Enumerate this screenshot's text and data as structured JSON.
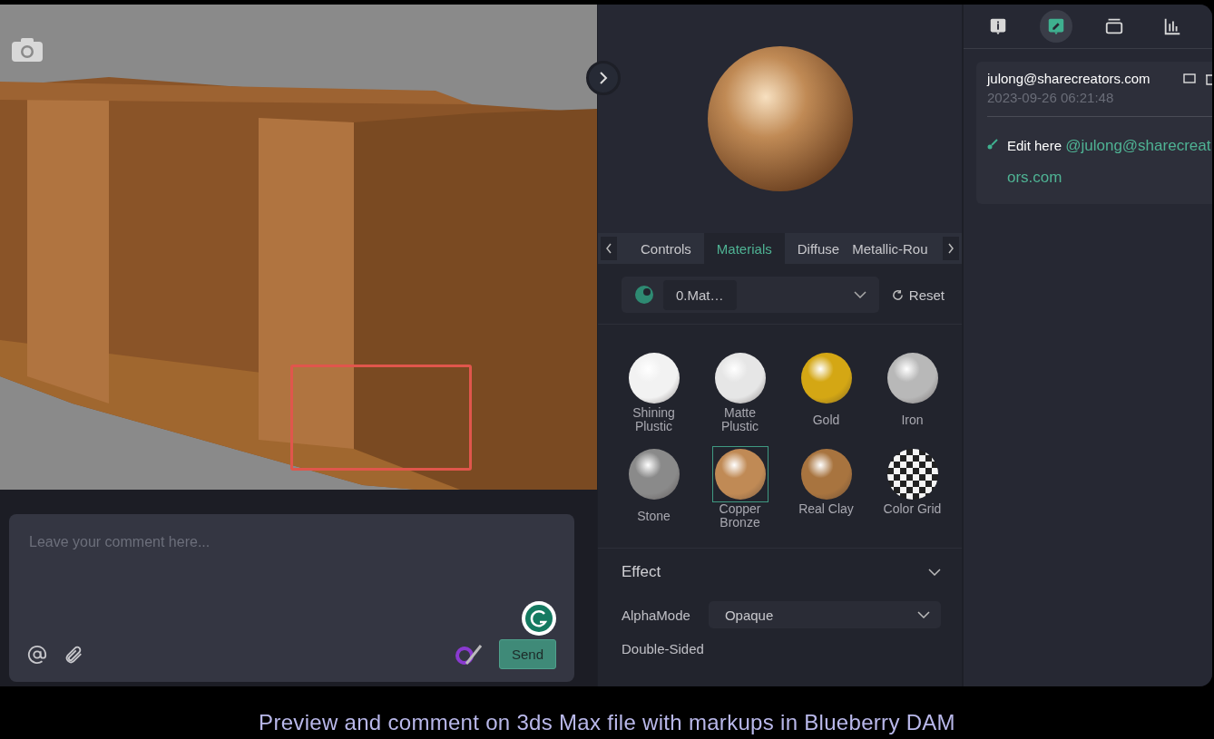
{
  "viewport": {
    "markup": true
  },
  "comment_box": {
    "placeholder": "Leave your comment here...",
    "send": "Send"
  },
  "material_panel": {
    "tabs": [
      {
        "label": "Controls",
        "selected": false
      },
      {
        "label": "Materials",
        "selected": true
      },
      {
        "label": "Diffuse",
        "selected": false
      },
      {
        "label": "Metallic-Rou",
        "selected": false
      }
    ],
    "material_select": "0.Mat…",
    "reset": "Reset",
    "materials": [
      {
        "name": "Shining Plustic",
        "kind": "solid",
        "color": "#f2f2f2",
        "selected": false
      },
      {
        "name": "Matte Plustic",
        "kind": "solid",
        "color": "#e6e6e6",
        "selected": false
      },
      {
        "name": "Gold",
        "kind": "solid",
        "color": "#d4a714",
        "selected": false
      },
      {
        "name": "Iron",
        "kind": "solid",
        "color": "#b8b8b8",
        "selected": false
      },
      {
        "name": "Stone",
        "kind": "solid",
        "color": "#8a8a8a",
        "selected": false
      },
      {
        "name": "Copper Bronze",
        "kind": "solid",
        "color": "#c08a55",
        "selected": true
      },
      {
        "name": "Real Clay",
        "kind": "solid",
        "color": "#a8743f",
        "selected": false
      },
      {
        "name": "Color Grid",
        "kind": "checker",
        "selected": false
      }
    ],
    "effect": {
      "title": "Effect",
      "expanded": true,
      "alpha_label": "AlphaMode",
      "alpha_value": "Opaque",
      "double_sided_label": "Double-Sided"
    }
  },
  "side_tabs": [
    {
      "selected": false
    },
    {
      "selected": true
    },
    {
      "selected": false
    },
    {
      "selected": false
    }
  ],
  "comments": [
    {
      "author": "julong@sharecreators.com",
      "date": "2023-09-26 06:21:48",
      "text": "Edit here",
      "mention": "@julong@sharecreators.com"
    }
  ],
  "caption": "Preview and comment on 3ds Max file with markups in Blueberry DAM"
}
